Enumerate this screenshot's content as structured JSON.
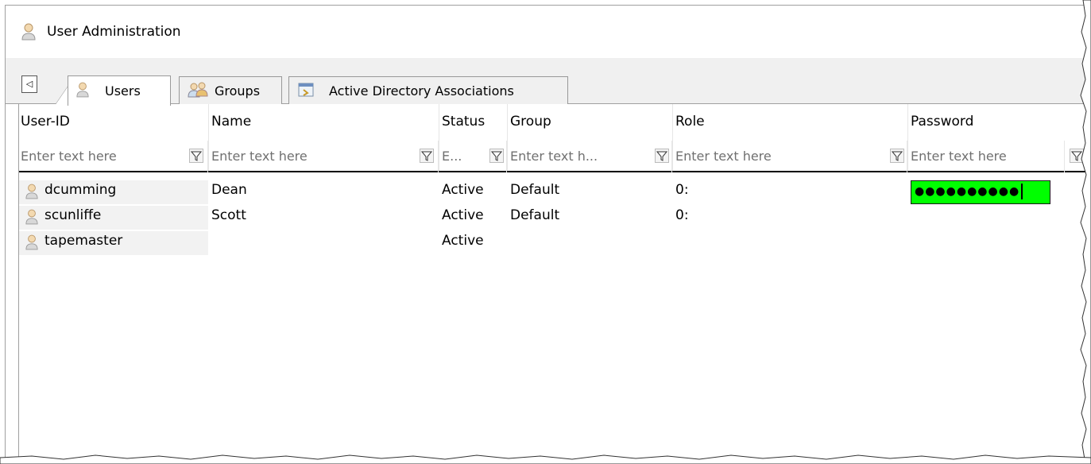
{
  "window": {
    "title": "User Administration"
  },
  "tabs": [
    {
      "label": "Users",
      "icon": "user-icon",
      "active": true
    },
    {
      "label": "Groups",
      "icon": "group-icon",
      "active": false
    },
    {
      "label": "Active Directory Associations",
      "icon": "active-directory-icon",
      "active": false
    }
  ],
  "scroll_left_glyph": "◁",
  "columns": [
    {
      "header": "User-ID",
      "filter_placeholder": "Enter text here"
    },
    {
      "header": "Name",
      "filter_placeholder": "Enter text here"
    },
    {
      "header": "Status",
      "filter_placeholder": "E..."
    },
    {
      "header": "Group",
      "filter_placeholder": "Enter text h..."
    },
    {
      "header": "Role",
      "filter_placeholder": "Enter text here"
    },
    {
      "header": "Password",
      "filter_placeholder": "Enter text here"
    }
  ],
  "rows": [
    {
      "user_id": "dcumming",
      "name": "Dean",
      "status": "Active",
      "group": "Default",
      "role": "0:",
      "password": "●●●●●●●●●●"
    },
    {
      "user_id": "scunliffe",
      "name": "Scott",
      "status": "Active",
      "group": "Default",
      "role": "0:",
      "password": ""
    },
    {
      "user_id": "tapemaster",
      "name": "",
      "status": "Active",
      "group": "",
      "role": "",
      "password": ""
    }
  ],
  "colors": {
    "password_edit_bg": "#00ff00",
    "tab_strip_bg": "#f0f0f0",
    "user_id_cell_bg": "#f2f2f2"
  }
}
